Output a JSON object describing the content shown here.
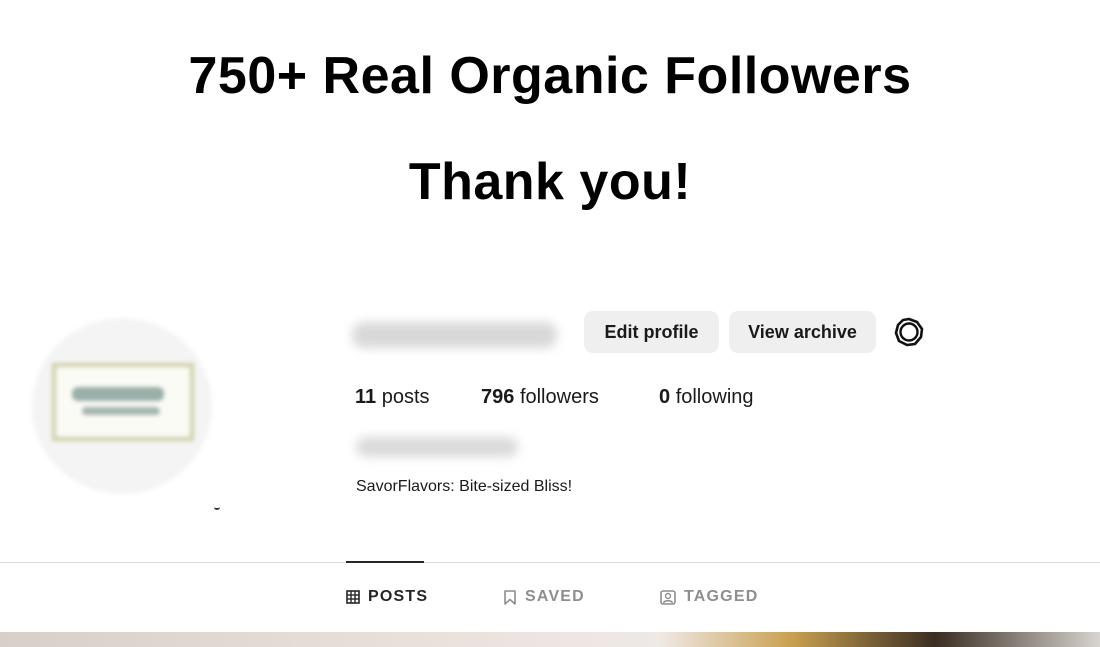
{
  "headline": {
    "title": "750+ Real Organic Followers",
    "subtitle": "Thank you!"
  },
  "profile": {
    "edit_button": "Edit profile",
    "archive_button": "View archive",
    "stats": {
      "posts_count": "11",
      "posts_label": "posts",
      "followers_count": "796",
      "followers_label": "followers",
      "following_count": "0",
      "following_label": "following"
    },
    "bio": "SavorFlavors: Bite-sized Bliss!"
  },
  "tabs": [
    {
      "label": "POSTS",
      "icon": "grid-icon",
      "active": true
    },
    {
      "label": "SAVED",
      "icon": "bookmark-icon",
      "active": false
    },
    {
      "label": "TAGGED",
      "icon": "tagged-user-icon",
      "active": false
    }
  ],
  "colors": {
    "button_bg": "#efefef",
    "active_tab": "#262626",
    "inactive_tab": "#8e8e8e",
    "divider": "#dbdbdb"
  }
}
